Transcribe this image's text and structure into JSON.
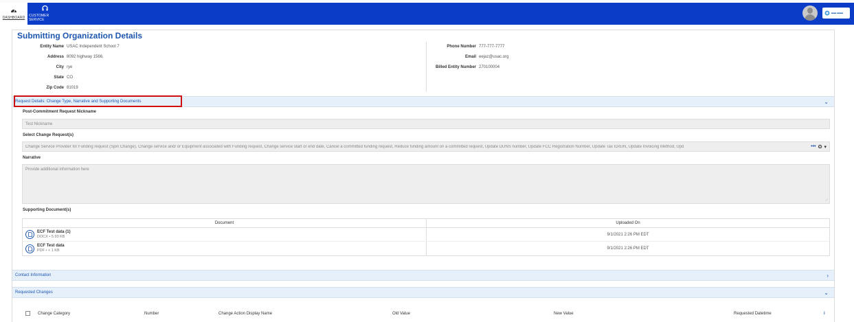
{
  "nav": {
    "items": [
      {
        "label": "DASHBOARD",
        "icon": "dashboard-icon"
      },
      {
        "label": "CUSTOMER SERVICE",
        "icon": "headset-icon"
      }
    ],
    "brand_color": "#0a3cc8"
  },
  "org": {
    "title": "Submitting Organization Details",
    "left": [
      {
        "key": "Entity Name",
        "value": "USAC Independent School 7"
      },
      {
        "key": "Address",
        "value": "8092 highway 1566,"
      },
      {
        "key": "City",
        "value": "rye"
      },
      {
        "key": "State",
        "value": "CO"
      },
      {
        "key": "Zip Code",
        "value": "81019"
      }
    ],
    "right": [
      {
        "key": "Phone Number",
        "value": "777-777-7777"
      },
      {
        "key": "Email",
        "value": "eejaz@usac.org"
      },
      {
        "key": "Billed Entity Number",
        "value": "270100004"
      }
    ]
  },
  "request": {
    "section_title": "Request Details: Change Type, Narrative and Supporting Documents",
    "nickname_label": "Post-Commitment Request Nickname",
    "nickname_value": "Test Nickname",
    "change_label": "Select Change Request(s)",
    "change_value": "Change Service Provider for Funding request (Spin Change), Change service and/ or Equipment associated with Funding request, Change service start or end date, Cancel a committed funding request, Reduce funding amount on a committed request, Update DUNS number, Update FCC Registration Number, Update Tax ID/EIN, Update Invoicing Method, Upd",
    "change_more": "•••",
    "narrative_label": "Narrative",
    "narrative_placeholder": "Provide additional information here",
    "docs_label": "Supporting Document(s)",
    "docs_headers": {
      "document": "Document",
      "uploaded": "Uploaded On"
    },
    "docs": [
      {
        "name": "ECF Test data (1)",
        "meta": "DOCX • 5.93 KB",
        "uploaded": "9/1/2021 2:26 PM EDT"
      },
      {
        "name": "ECF Test data",
        "meta": "PDF • < 1 KB",
        "uploaded": "9/1/2021 2:26 PM EDT"
      }
    ]
  },
  "contact": {
    "section_title": "Contact Information"
  },
  "changes": {
    "section_title": "Requested Changes",
    "columns": [
      "Change Category",
      "Number",
      "Change Action Display Name",
      "Old Value",
      "New Value",
      "Requested Datetime"
    ],
    "info_icon": "i"
  }
}
